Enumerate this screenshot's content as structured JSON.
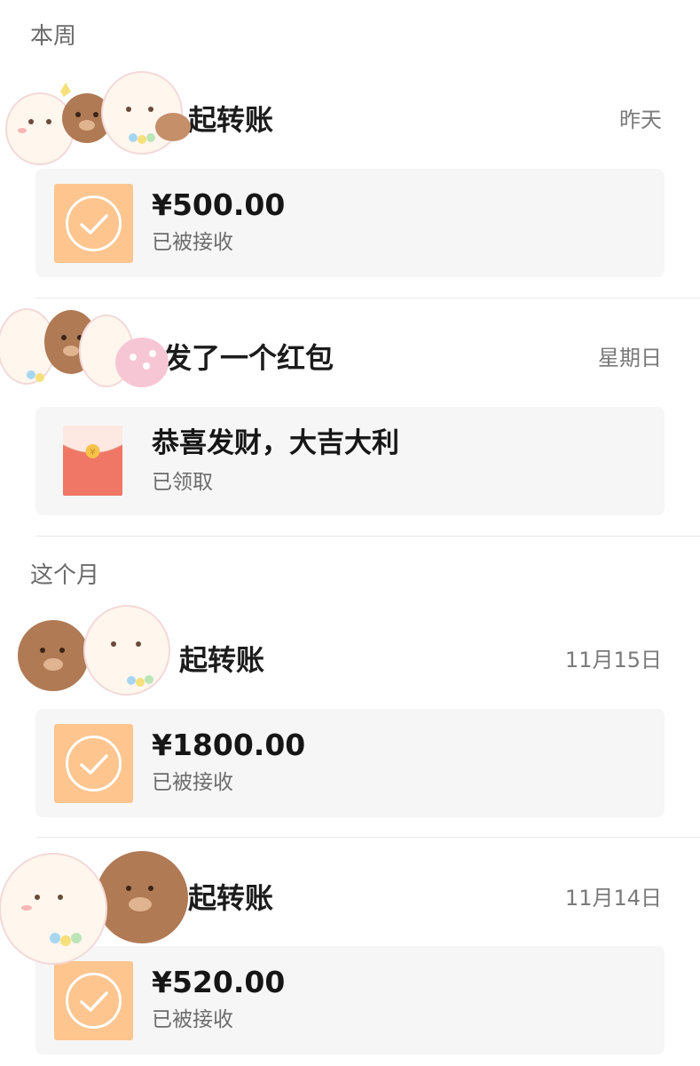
{
  "sections": {
    "this_week": "本周",
    "this_month": "这个月"
  },
  "entries": [
    {
      "title": "起转账",
      "date": "昨天",
      "amount": "¥500.00",
      "status": "已被接收",
      "type": "transfer"
    },
    {
      "title": "发了一个红包",
      "date": "星期日",
      "amount": "恭喜发财，大吉大利",
      "status": "已领取",
      "type": "red-packet"
    },
    {
      "title": "起转账",
      "date": "11月15日",
      "amount": "¥1800.00",
      "status": "已被接收",
      "type": "transfer"
    },
    {
      "title": "起转账",
      "date": "11月14日",
      "amount": "¥520.00",
      "status": "已被接收",
      "type": "transfer"
    }
  ],
  "colors": {
    "transfer_icon_bg": "#ffc58f",
    "red_packet": "#f07665",
    "card_bg": "#f6f6f6"
  },
  "icons": {
    "transfer": "check-circle-icon",
    "red_packet": "red-packet-icon",
    "sticker": "cute-bear-bunny-sticker"
  }
}
